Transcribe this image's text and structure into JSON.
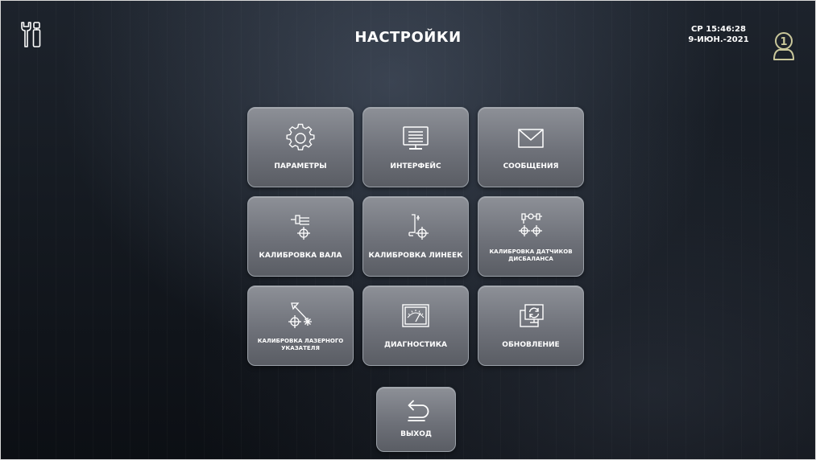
{
  "header": {
    "title": "НАСТРОЙКИ",
    "day_time": "СР 15:46:28",
    "date": "9-ИЮН.-2021",
    "user_number": "1"
  },
  "menu": {
    "parameters": "ПАРАМЕТРЫ",
    "interface": "ИНТЕРФЕЙС",
    "messages": "СООБЩЕНИЯ",
    "shaft_calibration": "КАЛИБРОВКА ВАЛА",
    "rulers_calibration": "КАЛИБРОВКА ЛИНЕЕК",
    "imbalance_sensors_calibration": "КАЛИБРОВКА ДАТЧИКОВ ДИСБАЛАНСА",
    "laser_pointer_calibration": "КАЛИБРОВКА ЛАЗЕРНОГО УКАЗАТЕЛЯ",
    "diagnostics": "ДИАГНОСТИКА",
    "update": "ОБНОВЛЕНИЕ",
    "exit": "ВЫХОД"
  },
  "icons": {
    "tools": "tools-icon",
    "user": "user-icon",
    "parameters": "gear-icon",
    "interface": "monitor-icon",
    "messages": "envelope-icon",
    "shaft_calibration": "shaft-crosshair-icon",
    "rulers_calibration": "ruler-crosshair-icon",
    "imbalance_sensors_calibration": "sensors-crosshair-icon",
    "laser_pointer_calibration": "laser-crosshair-icon",
    "diagnostics": "gauge-icon",
    "update": "refresh-monitor-icon",
    "exit": "return-arrow-icon"
  },
  "colors": {
    "user_badge": "#c9c79a",
    "tile_top": "#8d9097",
    "tile_bottom": "#5a5d64"
  }
}
